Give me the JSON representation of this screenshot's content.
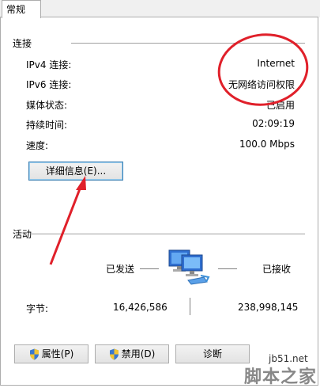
{
  "tab": {
    "label": "常规"
  },
  "connection": {
    "title": "连接",
    "rows": [
      {
        "label": "IPv4 连接:",
        "value": "Internet"
      },
      {
        "label": "IPv6 连接:",
        "value": "无网络访问权限"
      },
      {
        "label": "媒体状态:",
        "value": "已启用"
      },
      {
        "label": "持续时间:",
        "value": "02:09:19"
      },
      {
        "label": "速度:",
        "value": "100.0 Mbps"
      }
    ],
    "details_button": "详细信息(E)..."
  },
  "activity": {
    "title": "活动",
    "sent_label": "已发送",
    "received_label": "已接收",
    "bytes_label": "字节:",
    "bytes_sent": "16,426,586",
    "bytes_received": "238,998,145"
  },
  "buttons": {
    "properties": "属性(P)",
    "disable": "禁用(D)",
    "diagnose": "诊断"
  },
  "watermark": {
    "site": "jb51.net",
    "brand": "脚本之家"
  },
  "annotation_color": "#e0202a"
}
